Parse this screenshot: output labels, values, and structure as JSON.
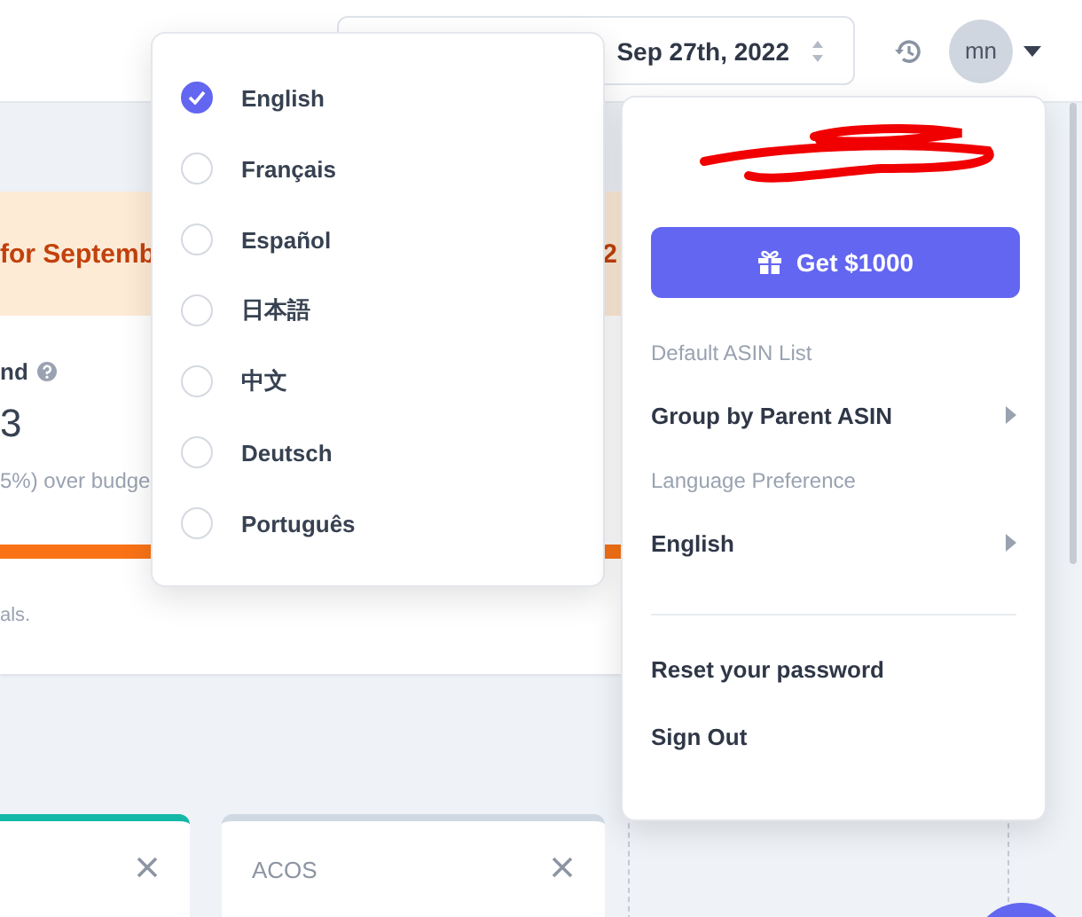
{
  "header": {
    "date_range": "Sep 27th, 2022",
    "avatar": "mn"
  },
  "banner": {
    "left_text": "for Septemb",
    "right_text": "2"
  },
  "spend_card": {
    "label": "nd",
    "value": "3",
    "note": "5%) over budge",
    "level": 1,
    "footer": "als."
  },
  "metric_cards": [
    {
      "color": "#14b8a6"
    },
    {
      "label": "ACOS",
      "color": "#cfd8e3"
    }
  ],
  "language_menu": {
    "options": [
      {
        "label": "English",
        "selected": true
      },
      {
        "label": "Français",
        "selected": false
      },
      {
        "label": "Español",
        "selected": false
      },
      {
        "label": "日本語",
        "selected": false
      },
      {
        "label": "中文",
        "selected": false
      },
      {
        "label": "Deutsch",
        "selected": false
      },
      {
        "label": "Português",
        "selected": false
      }
    ]
  },
  "account_menu": {
    "gift_button": "Get $1000",
    "sections": [
      {
        "heading": "Default ASIN List",
        "value": "Group by Parent ASIN"
      },
      {
        "heading": "Language Preference",
        "value": "English"
      }
    ],
    "actions": [
      "Reset your password",
      "Sign Out"
    ]
  }
}
